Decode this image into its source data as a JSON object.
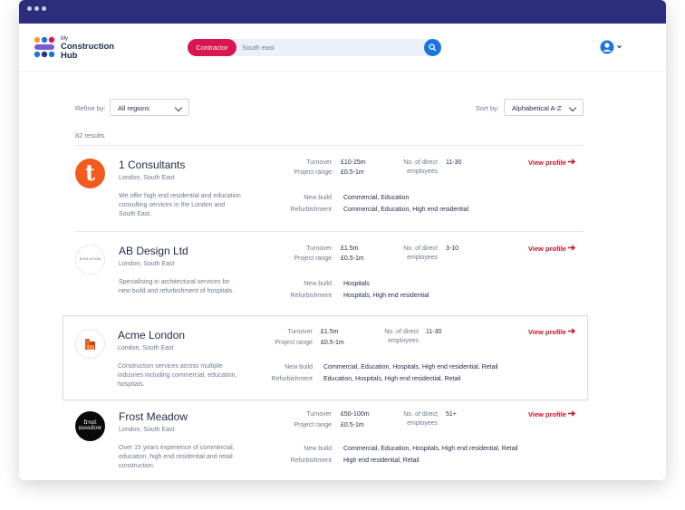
{
  "app": {
    "logo_line1": "My",
    "logo_line2": "Construction",
    "logo_line3": "Hub"
  },
  "search": {
    "category": "Contractor",
    "value": "South east"
  },
  "filters": {
    "refine_label": "Refine by:",
    "region": "All regions",
    "sort_label": "Sort by:",
    "sort": "Alphabetical A-Z",
    "results": "82 results"
  },
  "labels": {
    "turnover": "Turnover",
    "project_range": "Project range",
    "employees_1": "No. of direct",
    "employees_2": "employees",
    "new_build": "New build",
    "refurbishment": "Refurbishment",
    "view_profile": "View profile"
  },
  "companies": [
    {
      "name": "1 Consultants",
      "location": "London, South East",
      "description": "We offer high end residential and education consulting services in the London and South East.",
      "turnover": "£10-25m",
      "project_range": "£0.5-1m",
      "employees": "11-30",
      "new_build": "Commercial, Education",
      "refurbishment": "Commercial, Education, High end residential",
      "logo_letter": "t"
    },
    {
      "name": "AB Design Ltd",
      "location": "London, South East",
      "description": "Specialising in architectural services for new build and refurbishment of hospitals.",
      "turnover": "£1.5m",
      "project_range": "£0.5-1m",
      "employees": "3-10",
      "new_build": "Hospitals",
      "refurbishment": "Hospitals, High end residential",
      "logo_text": "EVOLUTION"
    },
    {
      "name": "Acme London",
      "location": "London, South East",
      "description": "Construction services across multiple indusries including commercial, education, hospitals.",
      "turnover": "£1.5m",
      "project_range": "£0.5-1m",
      "employees": "11-30",
      "new_build": "Commercial, Education, Hospitals, High end residential, Retail",
      "refurbishment": "Education, Hospitals, High end residential, Retail"
    },
    {
      "name": "Frost Meadow",
      "location": "London, South East",
      "description": "Over 15 years experience of commercial, education, high end residential and retail construction.",
      "turnover": "£50-100m",
      "project_range": "£0.5-1m",
      "employees": "51+",
      "new_build": "Commercial, Education, Hospitals, High end residential, Retail",
      "refurbishment": "High end residential, Retail",
      "logo_line1": "frost",
      "logo_line2": "meadow"
    }
  ],
  "colors": {
    "titlebar": "#2d2f7c",
    "accent": "#d8164f",
    "link": "#c8102e",
    "search_button": "#1c74e3"
  },
  "icons": [
    "search-icon",
    "user-icon",
    "chevron-down-icon",
    "arrow-right-icon"
  ]
}
